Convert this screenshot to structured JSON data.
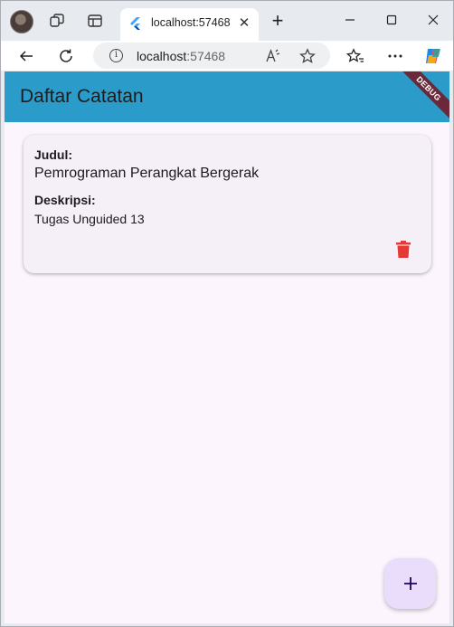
{
  "browser": {
    "tab": {
      "title": "localhost:57468",
      "close_glyph": "✕"
    },
    "new_tab_glyph": "+",
    "address": {
      "host": "localhost",
      "port": ":57468"
    },
    "icons": [
      "profile-avatar",
      "workspaces-icon",
      "tab-actions-icon",
      "flutter-favicon",
      "minimize-icon",
      "maximize-icon",
      "close-window-icon",
      "back-icon",
      "refresh-icon",
      "info-icon",
      "read-aloud-icon",
      "favorite-star-icon",
      "favorites-icon",
      "more-icon",
      "copilot-icon"
    ]
  },
  "app": {
    "title": "Daftar Catatan",
    "debug_banner": "DEBUG",
    "accent_color": "#2b9bc9",
    "notes": [
      {
        "title_label": "Judul:",
        "title": "Pemrograman Perangkat Bergerak",
        "desc_label": "Deskripsi:",
        "description": "Tugas Unguided 13",
        "delete_icon": "trash-icon",
        "delete_color": "#e53935"
      }
    ],
    "fab": {
      "icon": "plus-icon",
      "glyph": "+"
    }
  }
}
